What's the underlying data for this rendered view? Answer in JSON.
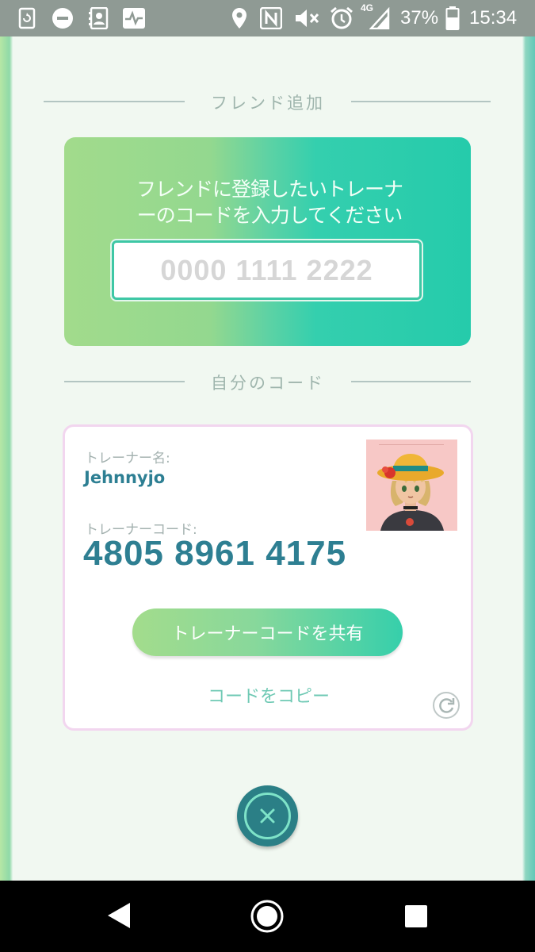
{
  "status_bar": {
    "battery_percent": "37%",
    "time": "15:34",
    "network": "4G",
    "icons": [
      "screen-rotate-icon",
      "do-not-disturb-icon",
      "contacts-icon",
      "activity-icon",
      "location-icon",
      "nfc-icon",
      "mute-icon",
      "alarm-icon",
      "signal-icon",
      "battery-icon"
    ]
  },
  "add_friend": {
    "section_title": "フレンド追加",
    "message_line1": "フレンドに登録したいトレーナ",
    "message_line2": "ーのコードを入力してください",
    "input_placeholder": "0000 1111 2222",
    "input_value": ""
  },
  "my_code": {
    "section_title": "自分のコード",
    "trainer_name_label": "トレーナー名:",
    "trainer_name": "Jehnnyjo",
    "trainer_code_label": "トレーナーコード:",
    "trainer_code": "4805 8961 4175",
    "share_button": "トレーナーコードを共有",
    "copy_link": "コードをコピー"
  },
  "colors": {
    "accent_teal": "#2e7f92",
    "gradient_start": "#a2db8c",
    "gradient_end": "#25cbab",
    "card_border": "#f2d6ef"
  }
}
